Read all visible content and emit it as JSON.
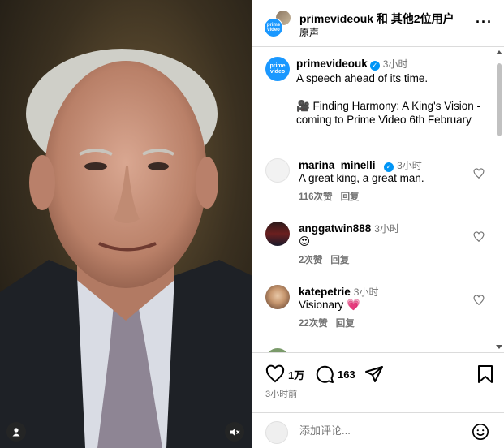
{
  "post": {
    "header": {
      "title_user": "primevideouk",
      "title_rest": " 和 其他2位用户",
      "subtitle": "原声",
      "more_icon": "more-options-icon"
    },
    "caption": {
      "username": "primevideouk",
      "time": "3小时",
      "line1": "A speech ahead of its time.",
      "line2": "🎥 Finding Harmony: A King's Vision - coming to Prime Video 6th February"
    },
    "comments": [
      {
        "username": "marina_minelli_",
        "verified": true,
        "time": "3小时",
        "text": "A great king, a great man.",
        "likes": "116次赞",
        "reply": "回复"
      },
      {
        "username": "anggatwin888",
        "verified": false,
        "time": "3小时",
        "text": "😍",
        "likes": "2次赞",
        "reply": "回复"
      },
      {
        "username": "katepetrie",
        "verified": false,
        "time": "3小时",
        "text": "Visionary 💗",
        "likes": "22次赞",
        "reply": "回复"
      }
    ],
    "actions": {
      "likes": "1万",
      "comments": "163",
      "posted_ago": "3小时前"
    },
    "add_comment": {
      "placeholder": "添加评论..."
    }
  },
  "colors": {
    "accent": "#0095f6",
    "brand": "#1a98ff",
    "muted": "#737373",
    "divider": "#dbdbdb"
  }
}
